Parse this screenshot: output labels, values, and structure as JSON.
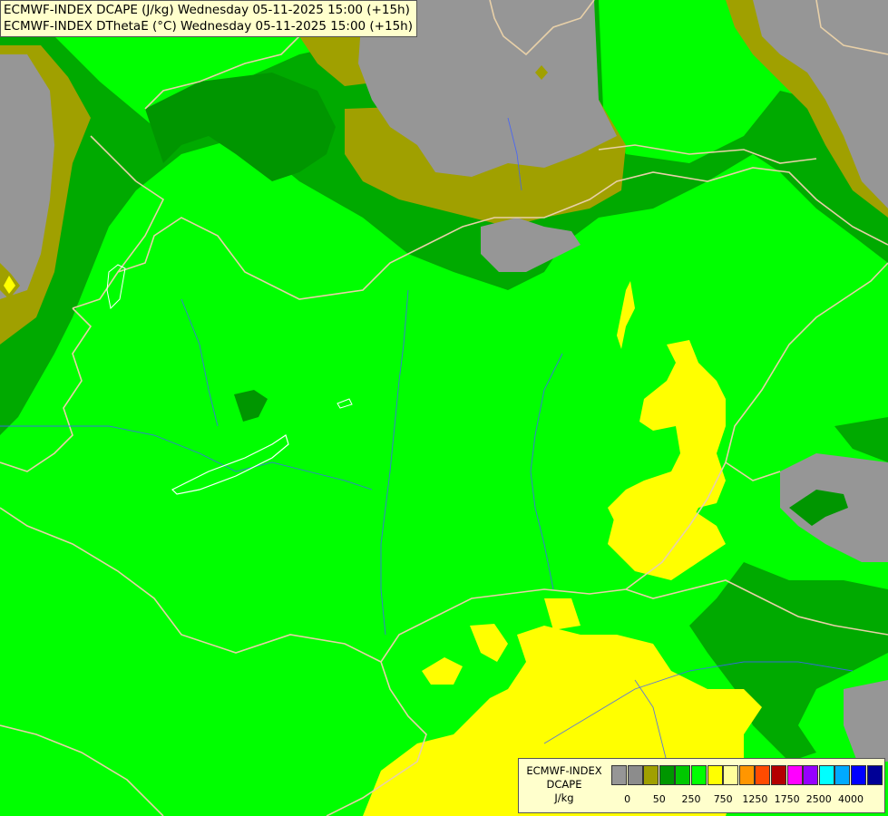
{
  "header": {
    "line1": "ECMWF-INDEX DCAPE (J/kg) Wednesday 05-11-2025 15:00 (+15h)",
    "line2": "ECMWF-INDEX DThetaE (°C) Wednesday 05-11-2025 15:00 (+15h)"
  },
  "legend": {
    "title_line1": "ECMWF-INDEX",
    "title_line2": "DCAPE",
    "title_line3": "J/kg",
    "colors": [
      "#969696",
      "#8c8c8c",
      "#a0a000",
      "#009600",
      "#00c800",
      "#00ff00",
      "#ffff00",
      "#ffff9b",
      "#ff9600",
      "#ff4b00",
      "#b40000",
      "#ff00ff",
      "#9600ff",
      "#00ffff",
      "#00aaff",
      "#0000ff",
      "#000096"
    ],
    "ticks": [
      "0",
      "50",
      "250",
      "750",
      "1250",
      "1750",
      "2500",
      "4000"
    ]
  },
  "palette": {
    "grey": "#969696",
    "olive": "#a0a000",
    "dark_green": "#009600",
    "mid_green": "#00c800",
    "bright_green": "#00ff00",
    "yellow": "#ffff00",
    "border": "#e8d0a8",
    "river": "#4060ff"
  }
}
